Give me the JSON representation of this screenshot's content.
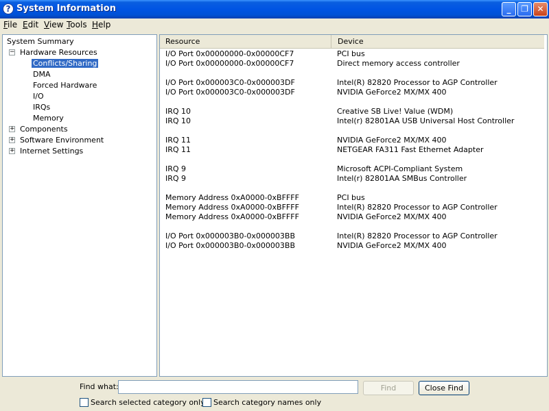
{
  "window": {
    "title": "System Information",
    "icon_glyph": "?",
    "minimize_glyph": "_",
    "maximize_glyph": "❐",
    "close_glyph": "✕"
  },
  "menu": [
    {
      "label": "File",
      "hotkey": "F"
    },
    {
      "label": "Edit",
      "hotkey": "E"
    },
    {
      "label": "View",
      "hotkey": "V"
    },
    {
      "label": "Tools",
      "hotkey": "T"
    },
    {
      "label": "Help",
      "hotkey": "H"
    }
  ],
  "tree": {
    "root": "System Summary",
    "hardware": {
      "label": "Hardware Resources",
      "expanded": true,
      "children": [
        "Conflicts/Sharing",
        "DMA",
        "Forced Hardware",
        "I/O",
        "IRQs",
        "Memory"
      ],
      "selected": "Conflicts/Sharing"
    },
    "collapsed": [
      "Components",
      "Software Environment",
      "Internet Settings"
    ]
  },
  "list": {
    "columns": [
      "Resource",
      "Device"
    ],
    "groups": [
      [
        {
          "resource": "I/O Port 0x00000000-0x00000CF7",
          "device": "PCI bus"
        },
        {
          "resource": "I/O Port 0x00000000-0x00000CF7",
          "device": "Direct memory access controller"
        }
      ],
      [
        {
          "resource": "I/O Port 0x000003C0-0x000003DF",
          "device": "Intel(R) 82820 Processor to AGP Controller"
        },
        {
          "resource": "I/O Port 0x000003C0-0x000003DF",
          "device": "NVIDIA GeForce2 MX/MX 400"
        }
      ],
      [
        {
          "resource": "IRQ 10",
          "device": "Creative SB Live! Value (WDM)"
        },
        {
          "resource": "IRQ 10",
          "device": "Intel(r) 82801AA USB Universal Host Controller"
        }
      ],
      [
        {
          "resource": "IRQ 11",
          "device": "NVIDIA GeForce2 MX/MX 400"
        },
        {
          "resource": "IRQ 11",
          "device": "NETGEAR FA311 Fast Ethernet Adapter"
        }
      ],
      [
        {
          "resource": "IRQ 9",
          "device": "Microsoft ACPI-Compliant System"
        },
        {
          "resource": "IRQ 9",
          "device": "Intel(r) 82801AA SMBus Controller"
        }
      ],
      [
        {
          "resource": "Memory Address 0xA0000-0xBFFFF",
          "device": "PCI bus"
        },
        {
          "resource": "Memory Address 0xA0000-0xBFFFF",
          "device": "Intel(R) 82820 Processor to AGP Controller"
        },
        {
          "resource": "Memory Address 0xA0000-0xBFFFF",
          "device": "NVIDIA GeForce2 MX/MX 400"
        }
      ],
      [
        {
          "resource": "I/O Port 0x000003B0-0x000003BB",
          "device": "Intel(R) 82820 Processor to AGP Controller"
        },
        {
          "resource": "I/O Port 0x000003B0-0x000003BB",
          "device": "NVIDIA GeForce2 MX/MX 400"
        }
      ]
    ]
  },
  "find": {
    "label": "Find what:",
    "value": "",
    "find_button": "Find",
    "close_button": "Close Find",
    "checkbox_selected": {
      "label": "Search selected category only",
      "checked": false
    },
    "checkbox_names": {
      "label": "Search category names only",
      "checked": false
    }
  }
}
